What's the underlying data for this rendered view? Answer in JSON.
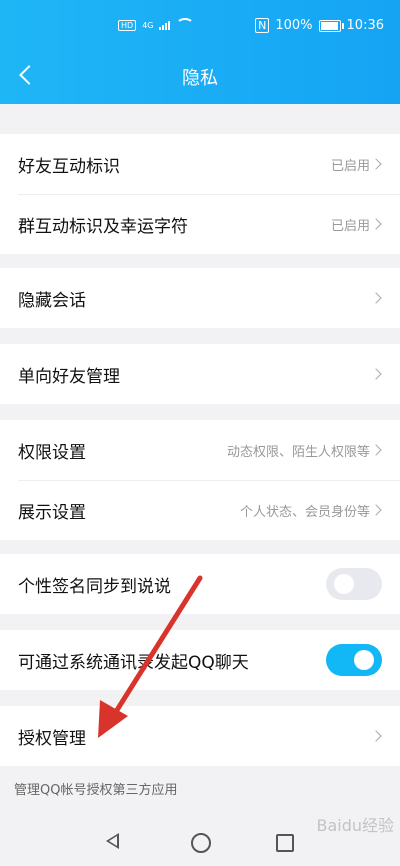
{
  "status_bar": {
    "hd": "HD",
    "signal": "4G",
    "nfc": "N",
    "battery_text": "100%",
    "battery_level": 1.0,
    "time": "10:36"
  },
  "header": {
    "title": "隐私",
    "back_icon": "chevron-left-icon"
  },
  "items": {
    "friend_interaction": {
      "label": "好友互动标识",
      "value": "已启用"
    },
    "group_interaction": {
      "label": "群互动标识及幸运字符",
      "value": "已启用"
    },
    "hidden_chat": {
      "label": "隐藏会话"
    },
    "oneway_friend": {
      "label": "单向好友管理"
    },
    "permission": {
      "label": "权限设置",
      "value": "动态权限、陌生人权限等"
    },
    "display": {
      "label": "展示设置",
      "value": "个人状态、会员身份等"
    },
    "signature_sync": {
      "label": "个性签名同步到说说",
      "toggle": false
    },
    "contacts_qq": {
      "label": "可通过系统通讯录发起QQ聊天",
      "toggle": true
    },
    "auth_manage": {
      "label": "授权管理"
    }
  },
  "footer_note": "管理QQ帐号授权第三方应用",
  "colors": {
    "accent": "#12b7f5",
    "annotation_arrow": "#d9342b"
  },
  "watermark": "Baidu经验"
}
